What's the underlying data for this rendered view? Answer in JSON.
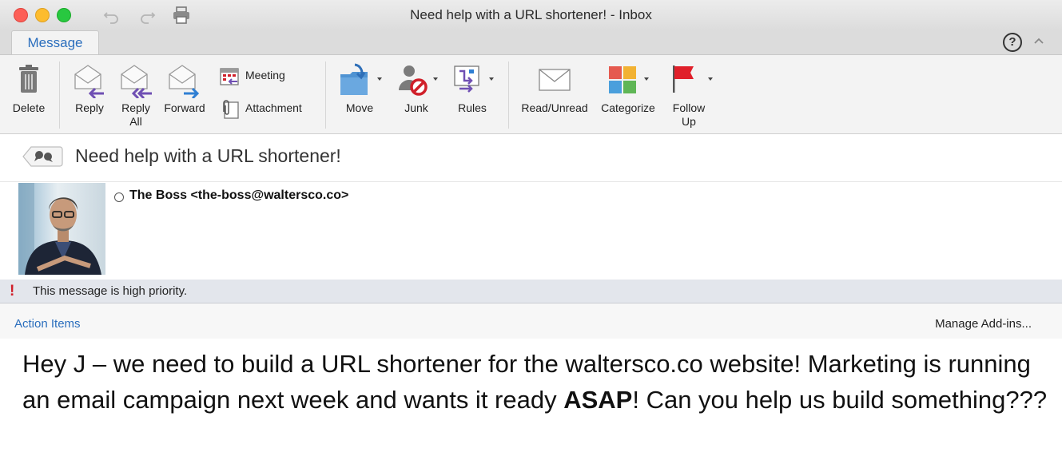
{
  "window": {
    "title": "Need help with a URL shortener! - Inbox"
  },
  "tabs": {
    "active": "Message"
  },
  "ribbon": {
    "delete": "Delete",
    "reply": "Reply",
    "reply_all_1": "Reply",
    "reply_all_2": "All",
    "forward": "Forward",
    "meeting": "Meeting",
    "attachment": "Attachment",
    "move": "Move",
    "junk": "Junk",
    "rules": "Rules",
    "read_unread": "Read/Unread",
    "categorize": "Categorize",
    "follow_up_1": "Follow",
    "follow_up_2": "Up"
  },
  "help": {
    "glyph": "?"
  },
  "message": {
    "subject": "Need help with a URL shortener!",
    "sender": "The Boss <the-boss@waltersco.co>",
    "priority_mark": "!",
    "priority_text": "This message is high priority.",
    "action_items": "Action Items",
    "manage_addins": "Manage Add-ins...",
    "body_part1": "Hey J – we need to build a URL shortener for the waltersco.co website!  Marketing is running an email campaign next week and wants it ready ",
    "body_bold": "ASAP",
    "body_part2": "!  Can you help us build something???"
  },
  "colors": {
    "accent": "#2a6ebd",
    "priority": "#d0202a",
    "close": "#fc5f57",
    "minimize": "#fdbc2e",
    "zoom": "#28c840"
  }
}
